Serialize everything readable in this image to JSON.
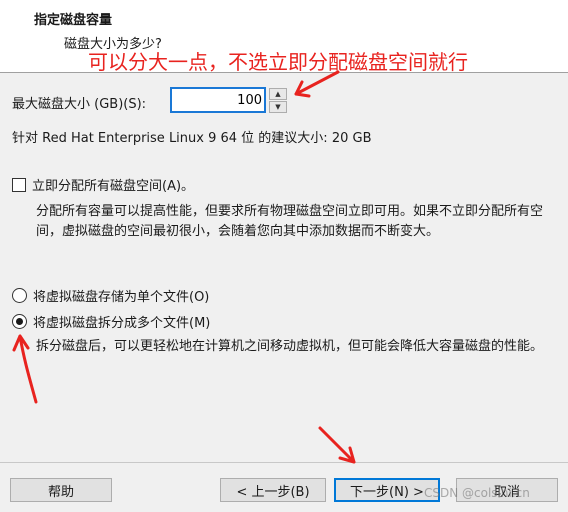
{
  "header": {
    "title": "指定磁盘容量",
    "subtitle": "磁盘大小为多少?"
  },
  "annotation": {
    "text": "可以分大一点，不选立即分配磁盘空间就行",
    "color": "#e8231f"
  },
  "size": {
    "label": "最大磁盘大小 (GB)(S):",
    "value": "100",
    "recommendation": "针对 Red Hat Enterprise Linux 9 64 位 的建议大小: 20 GB"
  },
  "allocate": {
    "label": "立即分配所有磁盘空间(A)。",
    "checked": false,
    "description": "分配所有容量可以提高性能，但要求所有物理磁盘空间立即可用。如果不立即分配所有空间，虚拟磁盘的空间最初很小，会随着您向其中添加数据而不断变大。"
  },
  "storage": {
    "single_label": "将虚拟磁盘存储为单个文件(O)",
    "multi_label": "将虚拟磁盘拆分成多个文件(M)",
    "selected": "multi",
    "multi_description": "拆分磁盘后，可以更轻松地在计算机之间移动虚拟机，但可能会降低大容量磁盘的性能。"
  },
  "buttons": {
    "help": "帮助",
    "back": "< 上一步(B)",
    "next": "下一步(N) >",
    "cancel": "取消"
  },
  "watermark": "CSDN @colsini.cn",
  "icons": {
    "spin_up": "spin-up-icon",
    "spin_down": "spin-down-icon",
    "annotation_arrow": "red-arrow-icon"
  },
  "colors": {
    "focus_border": "#1a78d6",
    "primary_border": "#0078d7",
    "header_bg": "#ffffff",
    "body_bg": "#f0f0f0"
  }
}
